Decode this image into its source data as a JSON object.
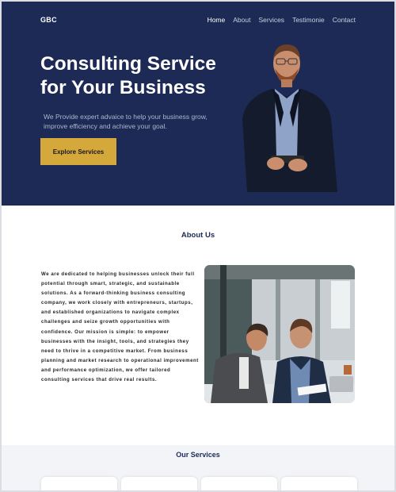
{
  "brand": {
    "logo": "GBC"
  },
  "nav": {
    "items": [
      "Home",
      "About",
      "Services",
      "Testimonie",
      "Contact"
    ],
    "active": "Home"
  },
  "hero": {
    "title_line1": "Consulting Service",
    "title_line2": "for Your Business",
    "subtitle": "We Provide expert advaice to help your business grow, improve efficiency and achieve your goal.",
    "cta_label": "Explore Services"
  },
  "about": {
    "title": "About Us",
    "body": "We are dedicated to helping businesses unlock their full potential through smart, strategic, and sustainable solutions. As a forward-thinking business consulting company, we work closely with entrepreneurs, startups, and established organizations to navigate complex challenges and seize growth opportunities with confidence. Our mission is simple: to empower businesses with the insight, tools, and strategies they need to thrive in a competitive market. From business planning and market research to operational improvement and performance optimization, we offer tailored consulting services that drive real results."
  },
  "services": {
    "title": "Our Services"
  },
  "colors": {
    "navy": "#1c2a55",
    "gold": "#d4a83a",
    "light_bg": "#f3f4f7"
  }
}
